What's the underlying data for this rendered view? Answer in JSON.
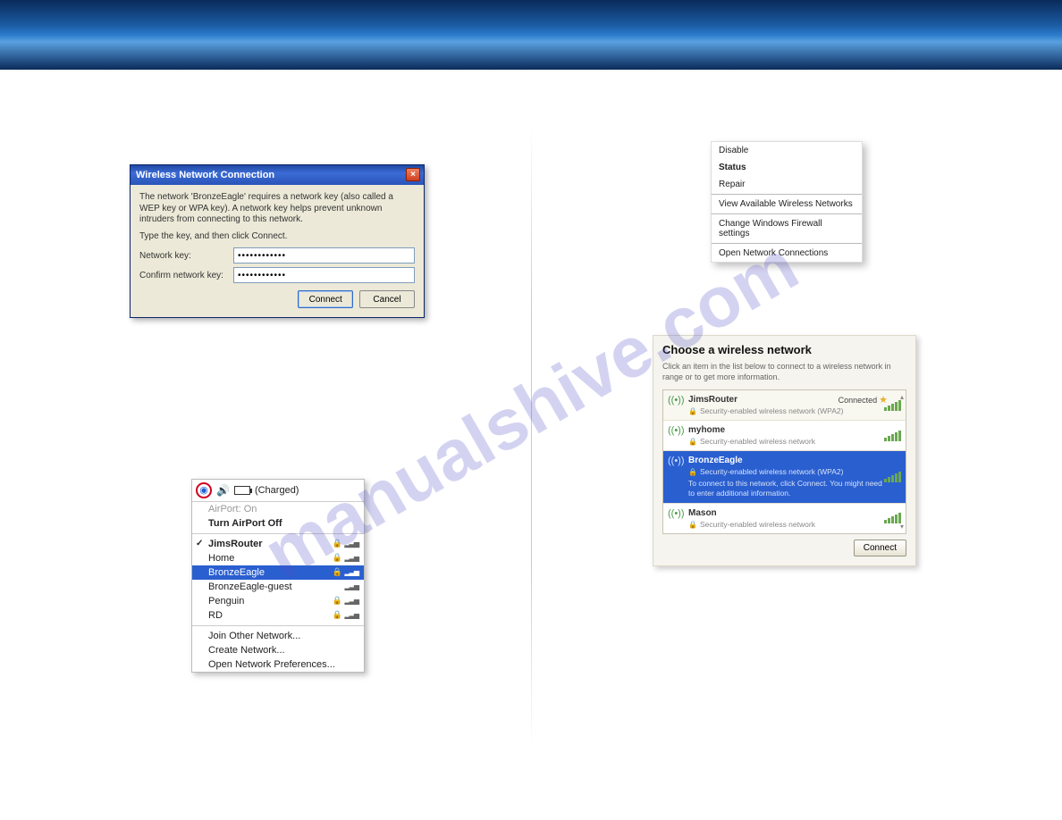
{
  "watermark": "manualshive.com",
  "xp": {
    "title": "Wireless Network Connection",
    "desc1": "The network 'BronzeEagle' requires a network key (also called a WEP key or WPA key). A network key helps prevent unknown intruders from connecting to this network.",
    "desc2": "Type the key, and then click Connect.",
    "key_label": "Network key:",
    "confirm_label": "Confirm network key:",
    "key_value": "••••••••••••",
    "confirm_value": "••••••••••••",
    "connect": "Connect",
    "cancel": "Cancel"
  },
  "mac": {
    "charged": "(Charged)",
    "airport_on": "AirPort: On",
    "turn_off": "Turn AirPort Off",
    "items": [
      {
        "label": "JimsRouter",
        "check": true,
        "lock": true
      },
      {
        "label": "Home",
        "lock": true
      },
      {
        "label": "BronzeEagle",
        "sel": true,
        "lock": true
      },
      {
        "label": "BronzeEagle-guest"
      },
      {
        "label": "Penguin",
        "lock": true
      },
      {
        "label": "RD",
        "lock": true
      }
    ],
    "join": "Join Other Network...",
    "create": "Create Network...",
    "prefs": "Open Network Preferences..."
  },
  "ctx": {
    "disable": "Disable",
    "status": "Status",
    "repair": "Repair",
    "view": "View Available Wireless Networks",
    "firewall": "Change Windows Firewall settings",
    "open": "Open Network Connections"
  },
  "choose": {
    "title": "Choose a wireless network",
    "sub": "Click an item in the list below to connect to a wireless network in range or to get more information.",
    "connected_label": "Connected",
    "connect_btn": "Connect",
    "rows": [
      {
        "name": "JimsRouter",
        "sec": "Security-enabled wireless network (WPA2)",
        "connected": true
      },
      {
        "name": "myhome",
        "sec": "Security-enabled wireless network"
      },
      {
        "name": "BronzeEagle",
        "sec": "Security-enabled wireless network (WPA2)",
        "extra": "To connect to this network, click Connect. You might need to enter additional information.",
        "sel": true
      },
      {
        "name": "Mason",
        "sec": "Security-enabled wireless network"
      }
    ]
  }
}
